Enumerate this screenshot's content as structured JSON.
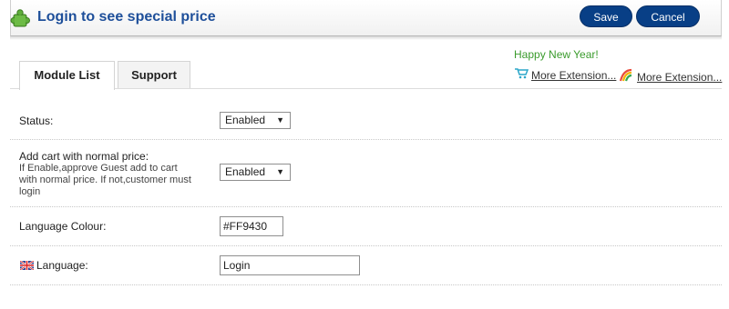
{
  "header": {
    "title": "Login to see special price",
    "save_label": "Save",
    "cancel_label": "Cancel",
    "icon": "puzzle-piece-icon"
  },
  "promo": {
    "greeting": "Happy New Year!",
    "links": [
      {
        "label": "More Extension...",
        "icon": "cart-icon"
      },
      {
        "label": "More Extension...",
        "icon": "rainbow-logo-icon"
      }
    ]
  },
  "tabs": [
    {
      "label": "Module List",
      "active": true
    },
    {
      "label": "Support",
      "active": false
    }
  ],
  "form": {
    "status": {
      "label": "Status:",
      "value": "Enabled"
    },
    "cart": {
      "label": "Add cart with normal price:",
      "help": "If Enable,approve Guest add to cart with normal price. If not,customer must login",
      "value": "Enabled"
    },
    "colour": {
      "label": "Language Colour:",
      "value": "#FF9430"
    },
    "language": {
      "label": "Language:",
      "value": "Login",
      "flag": "uk-flag-icon"
    }
  },
  "colors": {
    "accent": "#083f86",
    "title": "#1e4f9a",
    "promo": "#3a9b2c"
  }
}
